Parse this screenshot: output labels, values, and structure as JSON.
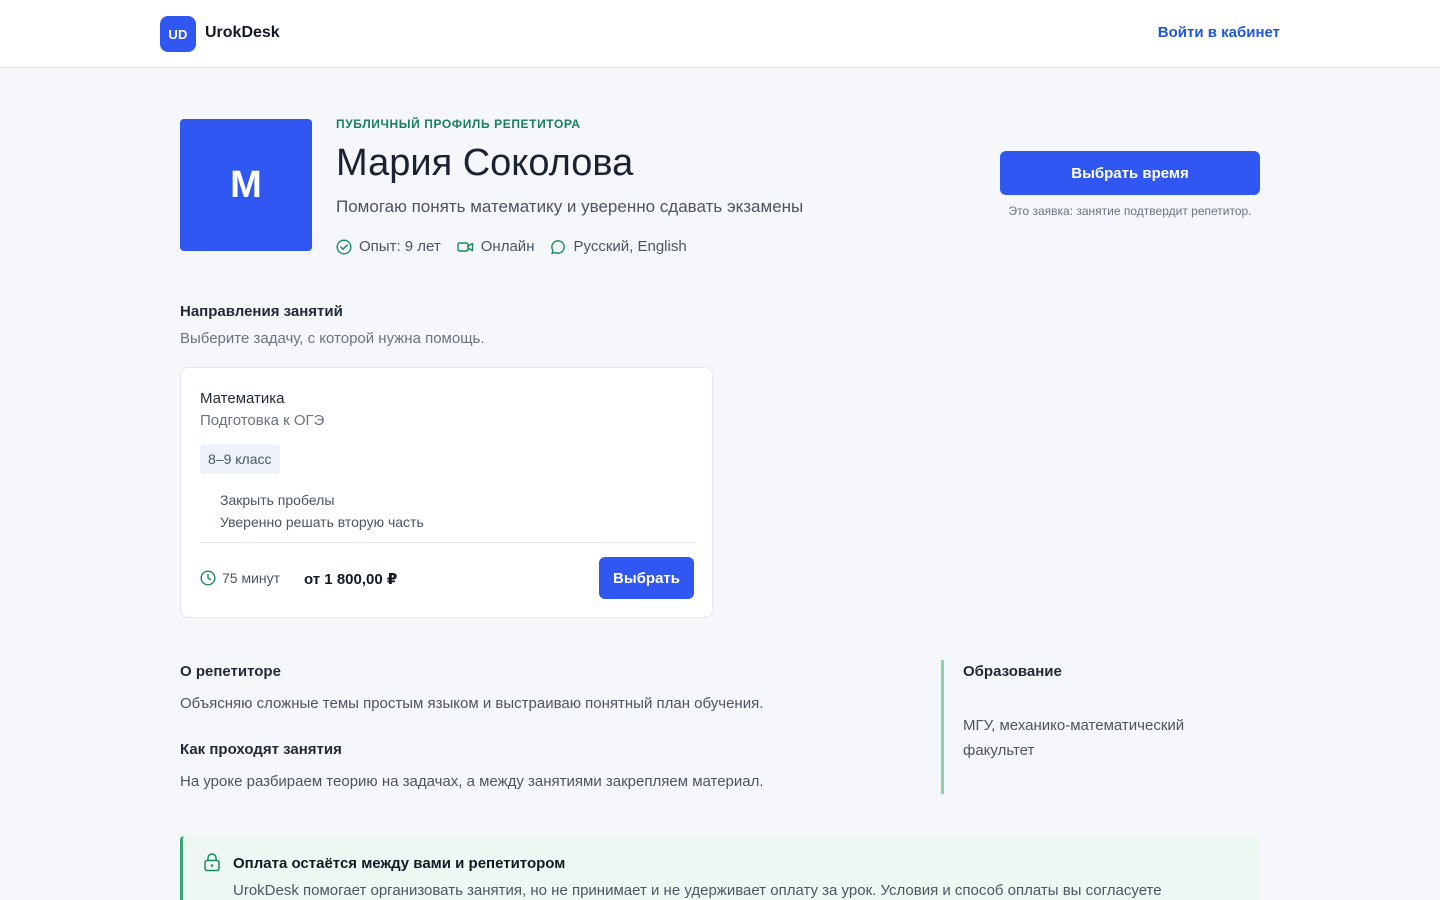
{
  "header": {
    "logo_badge": "UD",
    "brand_name": "UrokDesk",
    "login_label": "Войти в кабинет"
  },
  "profile": {
    "avatar_letter": "М",
    "eyebrow": "ПУБЛИЧНЫЙ ПРОФИЛЬ РЕПЕТИТОРА",
    "name": "Мария Соколова",
    "tagline": "Помогаю понять математику и уверенно сдавать экзамены",
    "meta": {
      "experience": "Опыт: 9 лет",
      "format": "Онлайн",
      "languages": "Русский, English"
    },
    "cta_label": "Выбрать время",
    "cta_note": "Это заявка: занятие подтвердит репетитор."
  },
  "directions": {
    "title": "Направления занятий",
    "subtitle": "Выберите задачу, с которой нужна помощь.",
    "services": [
      {
        "subject": "Математика",
        "goal": "Подготовка к ОГЭ",
        "grade": "8–9 класс",
        "points": [
          "Закрыть пробелы",
          "Уверенно решать вторую часть"
        ],
        "duration": "75 минут",
        "price": "от 1 800,00 ₽",
        "button_label": "Выбрать"
      }
    ]
  },
  "about": {
    "title": "О репетиторе",
    "text": "Объясняю сложные темы простым языком и выстраиваю понятный план обучения.",
    "lessons_title": "Как проходят занятия",
    "lessons_text": "На уроке разбираем теорию на задачах, а между занятиями закрепляем материал."
  },
  "education": {
    "title": "Образование",
    "text": "МГУ, механико-математический факультет"
  },
  "payment_notice": {
    "title": "Оплата остаётся между вами и репетитором",
    "text": "UrokDesk помогает организовать занятия, но не принимает и не удерживает оплату за урок. Условия и способ оплаты вы согласуете"
  },
  "colors": {
    "accent": "#3157f2",
    "link": "#1f56d6",
    "eyebrow_green": "#1a7f5a",
    "icon_green": "#1a8a5f",
    "education_border": "#86d6b4",
    "notice_bg": "#eef8f2",
    "notice_border": "#3aa677"
  },
  "icons": {
    "experience": "check-circle-icon",
    "format": "video-camera-icon",
    "languages": "chat-bubble-icon",
    "duration": "clock-icon",
    "payment": "lock-icon"
  }
}
